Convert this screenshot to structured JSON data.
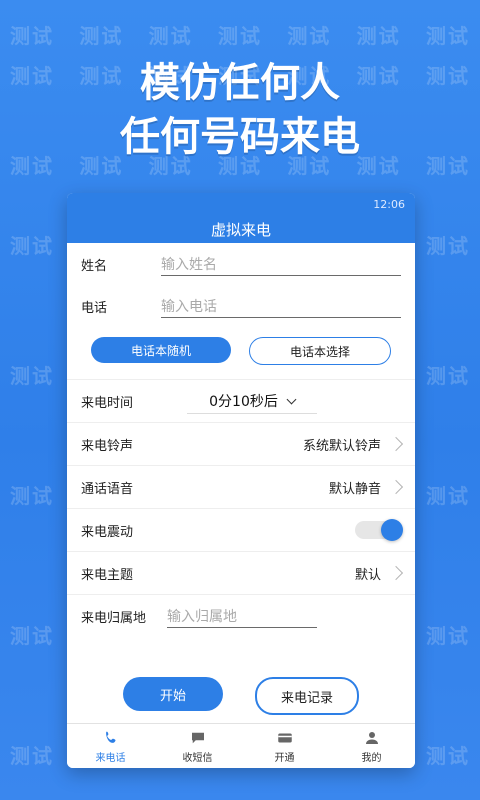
{
  "headline": {
    "line1": "模仿任何人",
    "line2": "任何号码来电"
  },
  "watermark_text": "测试",
  "app": {
    "status_time": "12:06",
    "title": "虚拟来电",
    "name_label": "姓名",
    "name_placeholder": "输入姓名",
    "phone_label": "电话",
    "phone_placeholder": "输入电话",
    "random_btn": "电话本随机",
    "select_btn": "电话本选择",
    "rows": [
      {
        "label": "来电时间",
        "value": "0分10秒后"
      },
      {
        "label": "来电铃声",
        "value": "系统默认铃声"
      },
      {
        "label": "通话语音",
        "value": "默认静音"
      },
      {
        "label": "来电震动"
      },
      {
        "label": "来电主题",
        "value": "默认"
      },
      {
        "label": "来电归属地",
        "placeholder": "输入归属地"
      }
    ],
    "start_btn": "开始",
    "history_btn": "来电记录",
    "tabs": [
      "来电话",
      "收短信",
      "开通",
      "我的"
    ]
  },
  "colors": {
    "accent": "#2d7fe6",
    "bg": "#3b8cf0"
  }
}
